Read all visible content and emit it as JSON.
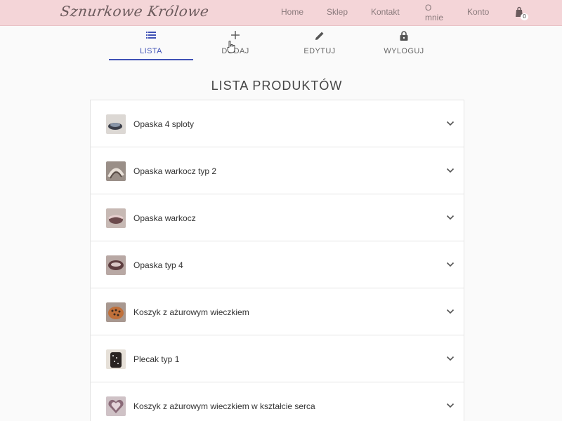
{
  "header": {
    "logo": "Sznurkowe Królowe",
    "nav": {
      "home": "Home",
      "shop": "Sklep",
      "contact": "Kontakt",
      "about": "O mnie",
      "account": "Konto"
    },
    "cart_count": "0"
  },
  "tabs": [
    {
      "label": "LISTA",
      "icon": "list-icon",
      "active": true
    },
    {
      "label": "DODAJ",
      "icon": "plus-icon",
      "active": false
    },
    {
      "label": "EDYTUJ",
      "icon": "pencil-icon",
      "active": false
    },
    {
      "label": "WYLOGUJ",
      "icon": "lock-icon",
      "active": false
    }
  ],
  "page_title": "LISTA PRODUKTÓW",
  "products": [
    {
      "name": "Opaska 4 sploty"
    },
    {
      "name": "Opaska warkocz typ 2"
    },
    {
      "name": "Opaska warkocz"
    },
    {
      "name": "Opaska typ 4"
    },
    {
      "name": "Koszyk z ażurowym wieczkiem"
    },
    {
      "name": "Plecak typ 1"
    },
    {
      "name": "Koszyk z ażurowym wieczkiem w kształcie serca"
    }
  ],
  "colors": {
    "header_bg": "#f4d5d8",
    "accent": "#3f51b5"
  }
}
